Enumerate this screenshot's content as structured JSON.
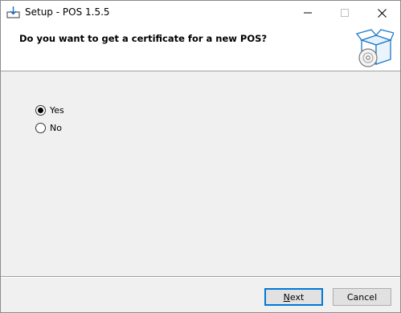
{
  "window": {
    "title": "Setup - POS 1.5.5",
    "controls": {
      "minimize_icon": "minimize-icon",
      "maximize_icon": "maximize-icon",
      "close_icon": "close-icon"
    }
  },
  "header": {
    "question": "Do you want to get a certificate for a new POS?",
    "icon": "setup-box-icon"
  },
  "options": [
    {
      "label": "Yes",
      "selected": true
    },
    {
      "label": "No",
      "selected": false
    }
  ],
  "footer": {
    "next_label": "Next",
    "cancel_label": "Cancel"
  },
  "colors": {
    "accent": "#0078d7",
    "background": "#f0f0f0",
    "header_background": "#ffffff"
  }
}
